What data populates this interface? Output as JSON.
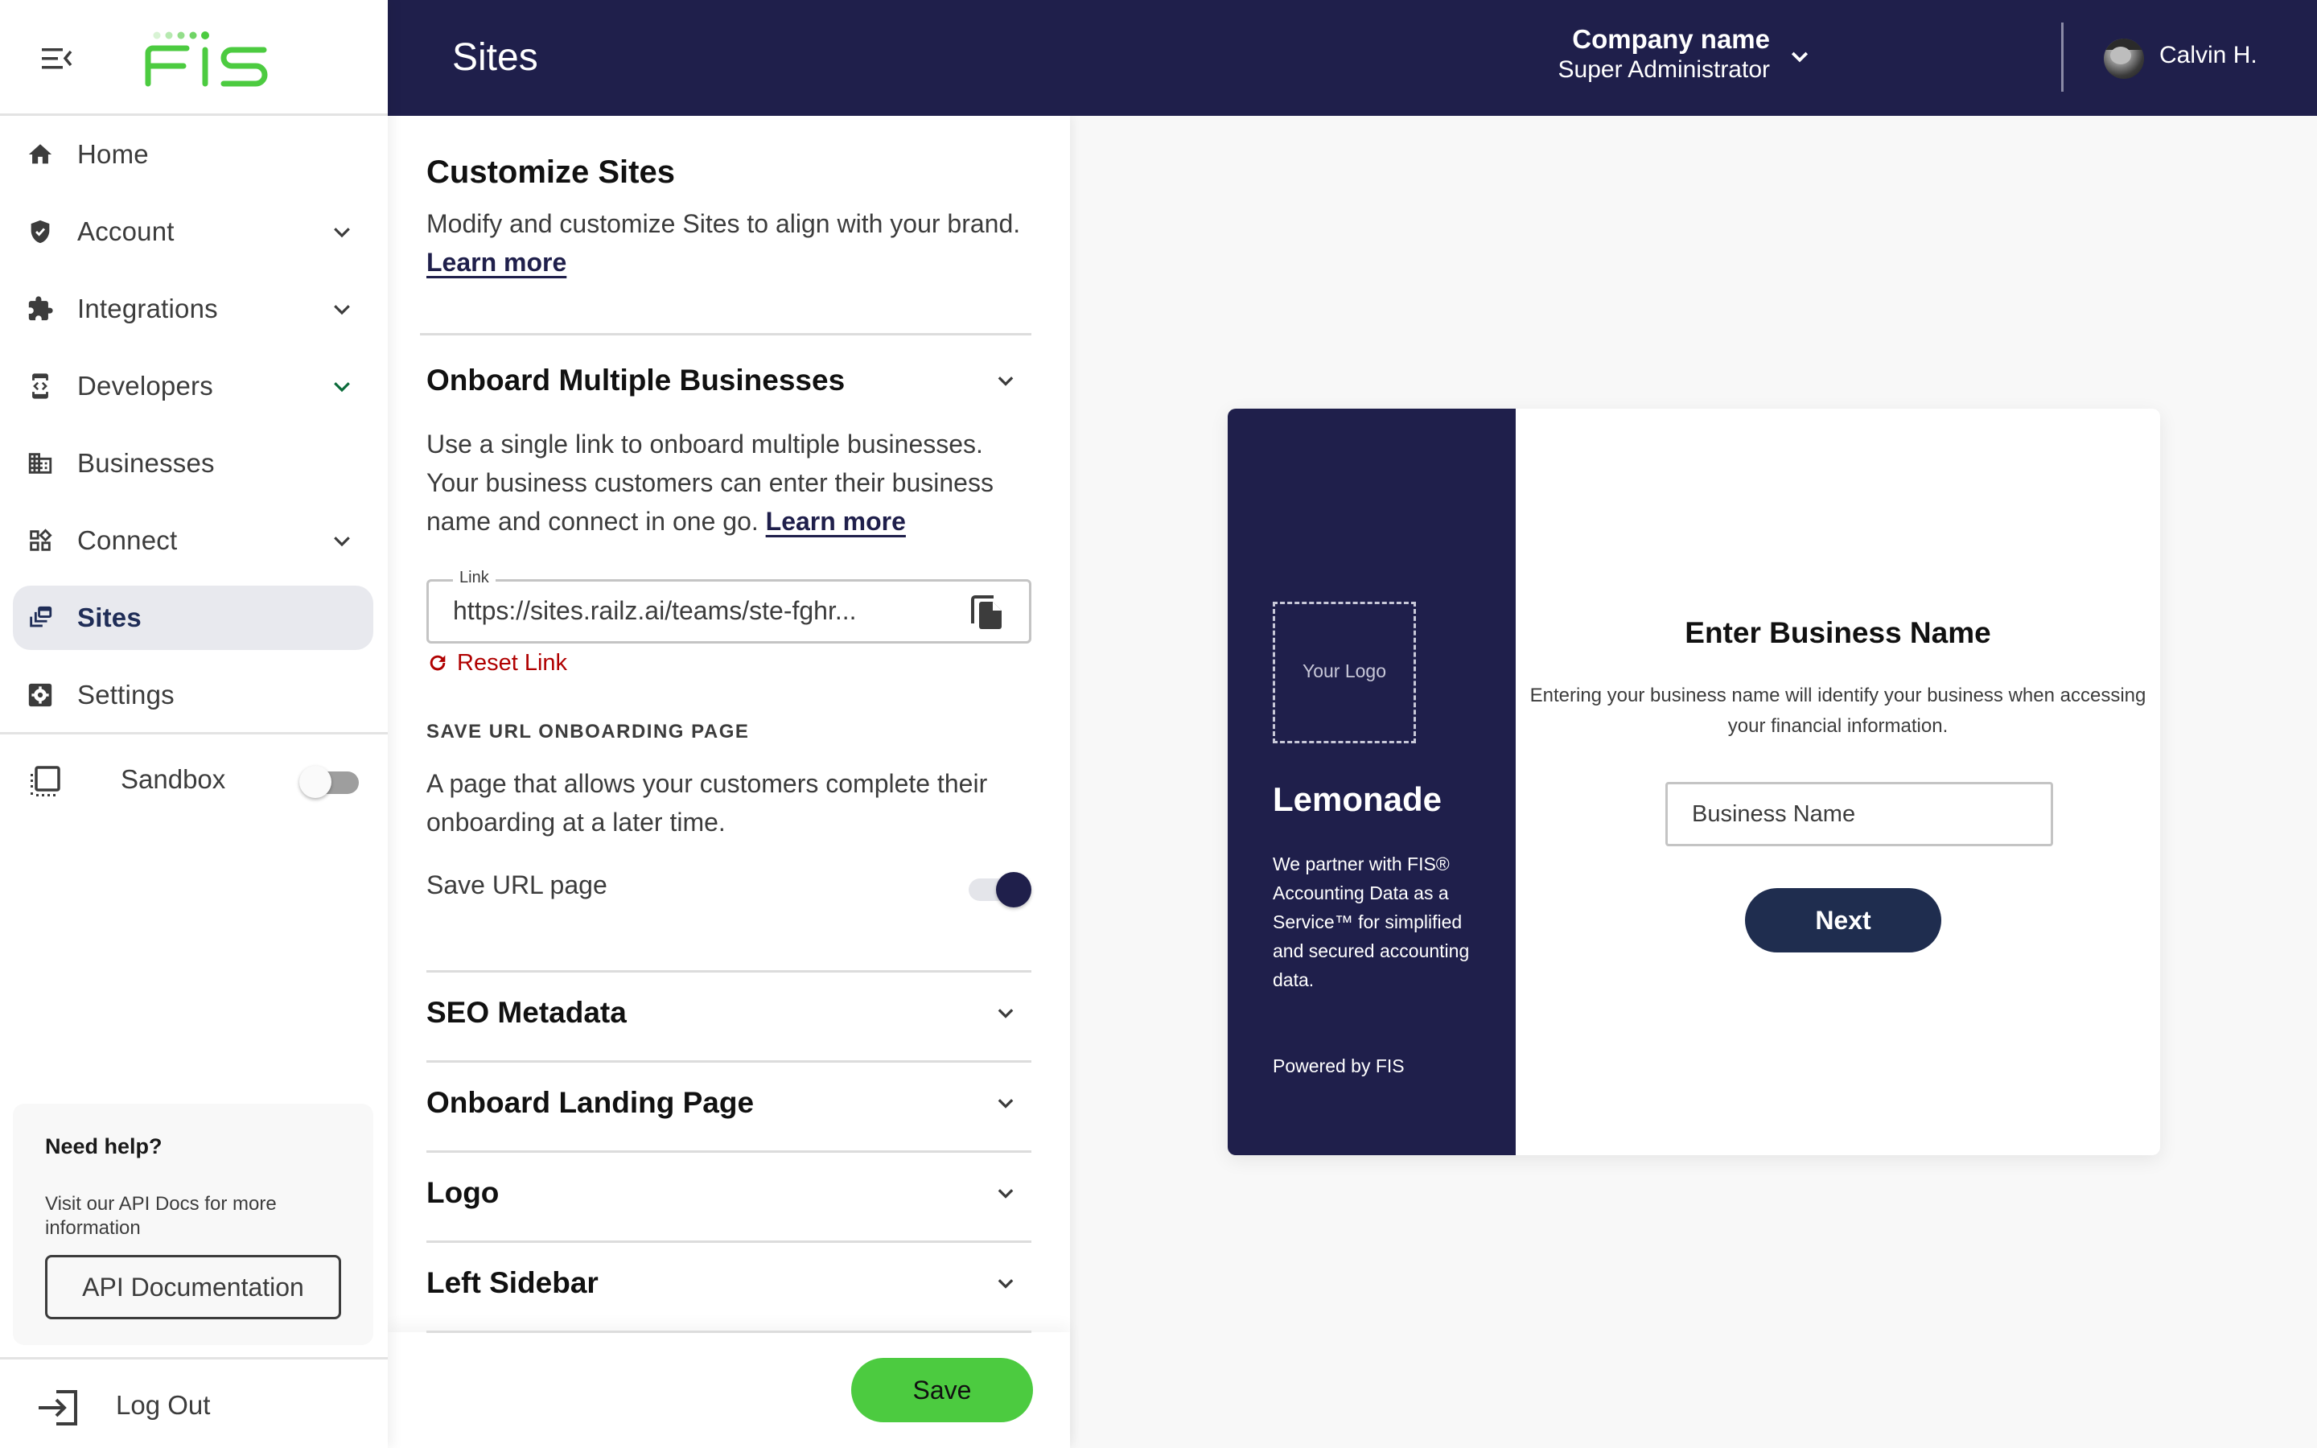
{
  "brand": {
    "logo_text": "FIS",
    "accent_color": "#4ccb40",
    "header_color": "#1f1f4b"
  },
  "header": {
    "title": "Sites",
    "company_name": "Company name",
    "role": "Super Administrator",
    "user_name": "Calvin H."
  },
  "sidebar": {
    "items": [
      {
        "label": "Home",
        "icon": "home-icon",
        "has_chevron": false,
        "active": false
      },
      {
        "label": "Account",
        "icon": "shield-check-icon",
        "has_chevron": true,
        "active": false
      },
      {
        "label": "Integrations",
        "icon": "puzzle-icon",
        "has_chevron": true,
        "active": false
      },
      {
        "label": "Developers",
        "icon": "developer-mode-icon",
        "has_chevron": true,
        "active": false
      },
      {
        "label": "Businesses",
        "icon": "building-icon",
        "has_chevron": false,
        "active": false
      },
      {
        "label": "Connect",
        "icon": "widgets-icon",
        "has_chevron": true,
        "active": false
      },
      {
        "label": "Sites",
        "icon": "sites-icon",
        "has_chevron": false,
        "active": true
      },
      {
        "label": "Settings",
        "icon": "settings-icon",
        "has_chevron": false,
        "active": false
      }
    ],
    "sandbox": {
      "label": "Sandbox",
      "enabled": false
    },
    "help": {
      "title": "Need help?",
      "text": "Visit our API Docs for more information",
      "button_label": "API Documentation"
    },
    "logout_label": "Log Out"
  },
  "panel": {
    "title": "Customize Sites",
    "description": "Modify and customize Sites to align with your brand.",
    "learn_more": "Learn more",
    "onboard_section": {
      "title": "Onboard Multiple Businesses",
      "description": "Use a single link to onboard multiple businesses. Your business customers can enter their business name and connect in one go.",
      "learn_more": "Learn more",
      "link_label": "Link",
      "link_value": "https://sites.railz.ai/teams/ste-fghr...",
      "reset_label": "Reset Link",
      "save_url_overline": "SAVE URL ONBOARDING PAGE",
      "save_url_description": "A page that allows your customers complete their onboarding at a later time.",
      "save_url_label": "Save URL page",
      "save_url_enabled": true
    },
    "sections": [
      {
        "title": "SEO Metadata"
      },
      {
        "title": "Onboard Landing Page"
      },
      {
        "title": "Logo"
      },
      {
        "title": "Left Sidebar"
      }
    ],
    "save_label": "Save"
  },
  "preview": {
    "logo_placeholder": "Your Logo",
    "brand_name": "Lemonade",
    "blurb": "We partner with FIS® Accounting Data as a Service™ for simplified and secured accounting data.",
    "powered_by": "Powered by FIS",
    "title": "Enter Business Name",
    "subtitle": "Entering your business name will identify your business when accessing your financial information.",
    "input_placeholder": "Business Name",
    "next_label": "Next"
  }
}
